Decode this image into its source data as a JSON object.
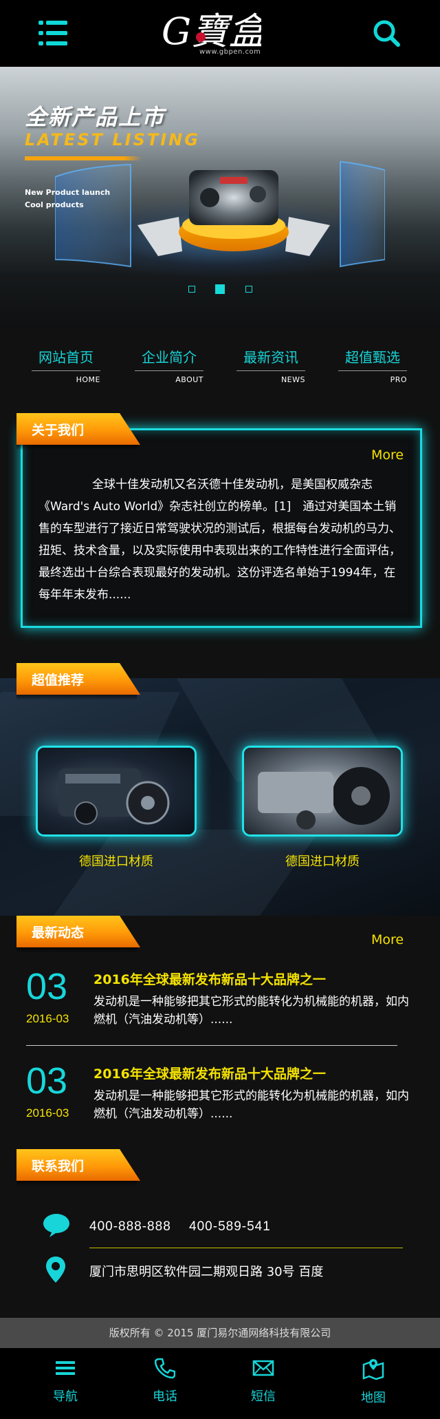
{
  "header": {
    "logo_text": "G寶盒",
    "logo_url": "www.gbpen.com",
    "menu_icon": "list-menu-icon",
    "search_icon": "search-icon"
  },
  "banner": {
    "title": "全新产品上市",
    "subtitle": "LATEST LISTING",
    "line1": "New Product launch",
    "line2": "Cool products",
    "slide_count": 3,
    "active_slide": 2
  },
  "nav": [
    {
      "cn": "网站首页",
      "en": "HOME"
    },
    {
      "cn": "企业简介",
      "en": "ABOUT"
    },
    {
      "cn": "最新资讯",
      "en": "NEWS"
    },
    {
      "cn": "超值甄选",
      "en": "PRO"
    }
  ],
  "about": {
    "heading": "关于我们",
    "more": "More",
    "text": "全球十佳发动机又名沃德十佳发动机，是美国权威杂志《Ward's Auto World》杂志社创立的榜单。[1]　通过对美国本土销售的车型进行了接近日常驾驶状况的测试后，根据每台发动机的马力、扭矩、技术含量，以及实际使用中表现出来的工作特性进行全面评估，最终选出十台综合表现最好的发动机。这份评选名单始于1994年，在每年年末发布......"
  },
  "recommend": {
    "heading": "超值推荐",
    "items": [
      {
        "caption": "德国进口材质"
      },
      {
        "caption": "德国进口材质"
      }
    ]
  },
  "news": {
    "heading": "最新动态",
    "more": "More",
    "items": [
      {
        "day": "03",
        "ym": "2016-03",
        "title": "2016年全球最新发布新品十大品牌之一",
        "body": "发动机是一种能够把其它形式的能转化为机械能的机器，如内燃机（汽油发动机等）......"
      },
      {
        "day": "03",
        "ym": "2016-03",
        "title": "2016年全球最新发布新品十大品牌之一",
        "body": "发动机是一种能够把其它形式的能转化为机械能的机器，如内燃机（汽油发动机等）......"
      }
    ]
  },
  "contact": {
    "heading": "联系我们",
    "phones": "400-888-888　 400-589-541",
    "address": "厦门市思明区软件园二期观日路 30号 百度",
    "phone_icon": "chat-bubble-icon",
    "address_icon": "location-pin-icon"
  },
  "copyright": "版权所有 © 2015 厦门易尔通网络科技有限公司",
  "tabbar": [
    {
      "label": "导航",
      "icon": "list-icon"
    },
    {
      "label": "电话",
      "icon": "phone-icon"
    },
    {
      "label": "短信",
      "icon": "envelope-icon"
    },
    {
      "label": "地图",
      "icon": "map-icon"
    }
  ],
  "colors": {
    "accent_cyan": "#17d5d8",
    "accent_yellow": "#f5e300",
    "header_orange": "#ff9908"
  }
}
